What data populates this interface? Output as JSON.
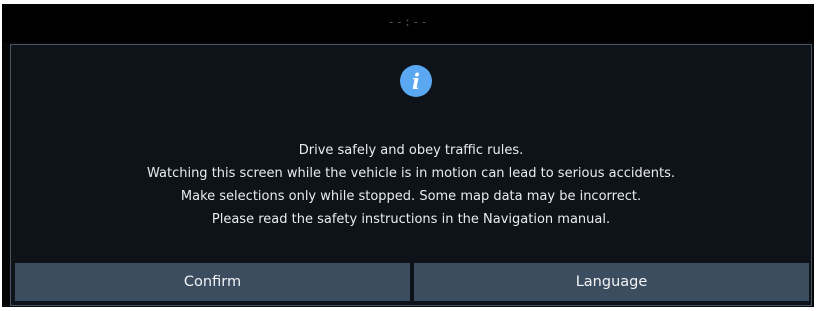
{
  "status_bar": {
    "clock": "--:--"
  },
  "dialog": {
    "icon": "info-icon",
    "icon_glyph": "i",
    "message_lines": [
      "Drive safely and obey traffic rules.",
      "Watching this screen while the vehicle is in motion can lead to serious accidents.",
      "Make selections only while stopped. Some map data may be incorrect.",
      "Please read the safety instructions in the Navigation manual."
    ],
    "buttons": {
      "confirm_label": "Confirm",
      "language_label": "Language"
    }
  },
  "colors": {
    "background": "#050607",
    "dialog_background": "#0e1319",
    "dialog_border": "#4a5561",
    "button": "#3d4d60",
    "info_icon": "#5aa8f2",
    "text": "#e9ecef"
  }
}
